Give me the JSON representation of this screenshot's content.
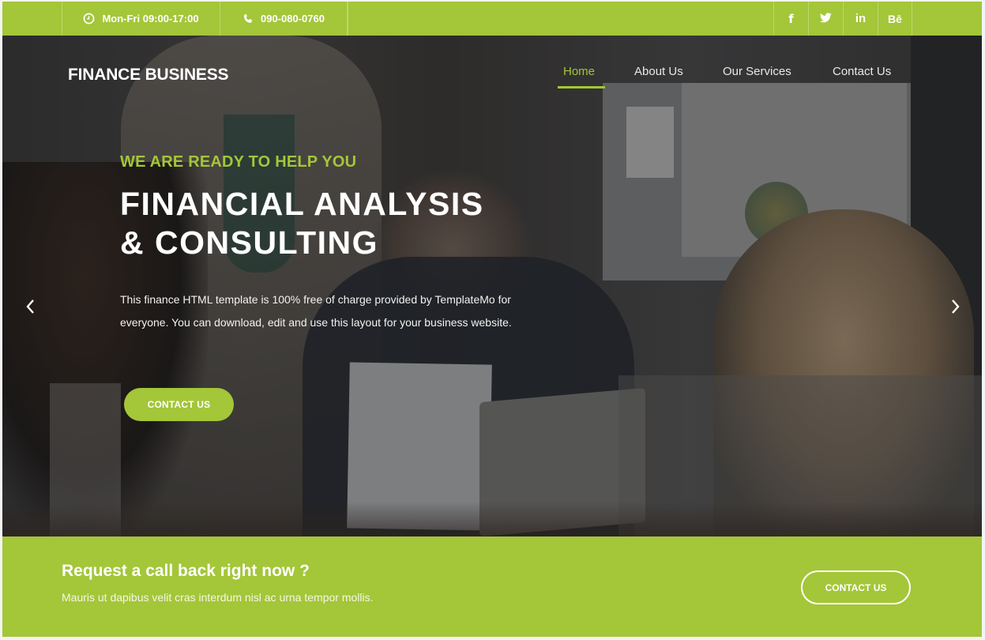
{
  "topbar": {
    "hours": "Mon-Fri 09:00-17:00",
    "hours_icon": "clock-icon",
    "phone": "090-080-0760",
    "phone_icon": "phone-icon",
    "social": [
      {
        "name": "facebook",
        "glyph": "f"
      },
      {
        "name": "twitter",
        "glyph": "t"
      },
      {
        "name": "linkedin",
        "glyph": "in"
      },
      {
        "name": "behance",
        "glyph": "Bē"
      }
    ]
  },
  "header": {
    "logo": "FINANCE BUSINESS",
    "nav": [
      {
        "label": "Home",
        "active": true
      },
      {
        "label": "About Us",
        "active": false
      },
      {
        "label": "Our Services",
        "active": false
      },
      {
        "label": "Contact Us",
        "active": false
      }
    ]
  },
  "hero": {
    "eyebrow": "WE ARE READY TO HELP YOU",
    "headline_line1": "FINANCIAL ANALYSIS",
    "headline_line2": "& CONSULTING",
    "lead": "This finance HTML template is 100% free of charge provided by TemplateMo for everyone. You can download, edit and use this layout for your business website.",
    "button": "CONTACT US",
    "prev_icon": "chevron-left-icon",
    "next_icon": "chevron-right-icon"
  },
  "callback": {
    "title": "Request a call back right now ?",
    "text": "Mauris ut dapibus velit cras interdum nisl ac urna tempor mollis.",
    "button": "CONTACT US"
  },
  "colors": {
    "accent": "#a4c639",
    "text_light": "#ffffff"
  }
}
